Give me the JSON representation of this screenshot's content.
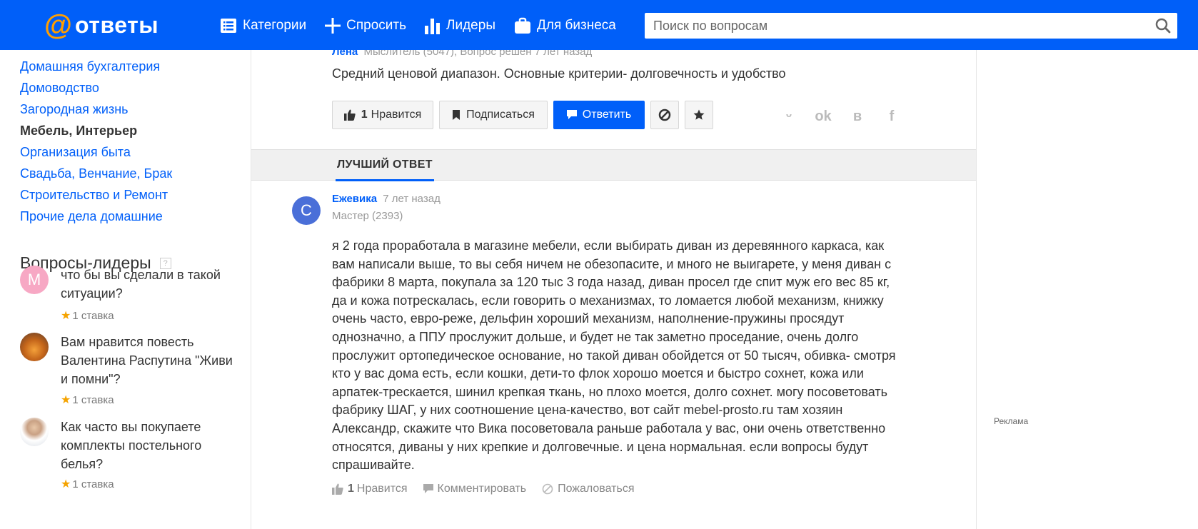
{
  "header": {
    "logo_at": "@",
    "logo_text": "ответы",
    "nav": [
      {
        "label": "Категории",
        "icon": "list-icon"
      },
      {
        "label": "Спросить",
        "icon": "plus-icon"
      },
      {
        "label": "Лидеры",
        "icon": "bar-chart-icon"
      },
      {
        "label": "Для бизнеса",
        "icon": "briefcase-icon"
      }
    ],
    "search_placeholder": "Поиск по вопросам"
  },
  "sidebar": {
    "categories": [
      {
        "label": "Домашняя бухгалтерия",
        "active": false
      },
      {
        "label": "Домоводство",
        "active": false
      },
      {
        "label": "Загородная жизнь",
        "active": false
      },
      {
        "label": "Мебель, Интерьер",
        "active": true
      },
      {
        "label": "Организация быта",
        "active": false
      },
      {
        "label": "Свадьба, Венчание, Брак",
        "active": false
      },
      {
        "label": "Строительство и Ремонт",
        "active": false
      },
      {
        "label": "Прочие дела домашние",
        "active": false
      }
    ],
    "leaders_title": "Вопросы-лидеры",
    "help_mark": "?",
    "leaders": [
      {
        "avatar_letter": "М",
        "question": "что бы вы сделали в такой ситуации?",
        "stake": "1 ставка"
      },
      {
        "avatar_letter": "",
        "question": "Вам нравится повесть Валентина Распутина \"Живи и помни\"?",
        "stake": "1 ставка"
      },
      {
        "avatar_letter": "",
        "question": "Как часто вы покупаете комплекты постельного белья?",
        "stake": "1 ставка"
      }
    ]
  },
  "question": {
    "author": "Лена",
    "meta": "Мыслитель (5047), Вопрос решён 7 лет назад",
    "text": "Средний ценовой диапазон. Основные критерии- долговечность и удобство",
    "like_count": "1",
    "like_label": "Нравится",
    "subscribe_label": "Подписаться",
    "reply_label": "Ответить"
  },
  "best_answer_tab": "ЛУЧШИЙ ОТВЕТ",
  "answer": {
    "avatar_letter": "С",
    "author": "Ежевика",
    "time": "7 лет назад",
    "rank": "Мастер (2393)",
    "text": "я 2 года проработала в магазине мебели, если выбирать диван из деревянного каркаса, как вам написали выше, то вы себя ничем не обезопасите, и много не выигарете, у меня диван с фабрики 8 марта, покупала за 120 тыс 3 года назад, диван просел где спит муж его вес 85 кг, да и кожа потрескалась, если говорить о механизмах, то ломается любой механизм, книжку очень часто, евро-реже, дельфин хороший механизм, наполнение-пружины просядут однозначно, а ППУ прослужит дольше, и будет не так заметно проседание, очень долго прослужит ортопедическое основание, но такой диван обойдется от 50 тысяч, обивка- смотря кто у вас дома есть, если кошки, дети-то флок хорошо моется и быстро сохнет, кожа или арпатек-трескается, шинил крепкая ткань, но плохо моется, долго сохнет. могу посоветовать фабрику ШАГ, у них соотношение цена-качество, вот сайт mebel-prosto.ru там хозяин Александр, скажите что Вика посоветовала раньше работала у вас, они очень ответственно относятся, диваны у них крепкие и долговечные. и цена нормальная. если вопросы будут спрашивайте.",
    "like_count": "1",
    "like_label": "Нравится",
    "comment_label": "Комментировать",
    "report_label": "Пожаловаться"
  },
  "ad_label": "Реклама",
  "colors": {
    "brand": "#005ff9",
    "accent": "#ff9e00",
    "star": "#f5a300"
  }
}
